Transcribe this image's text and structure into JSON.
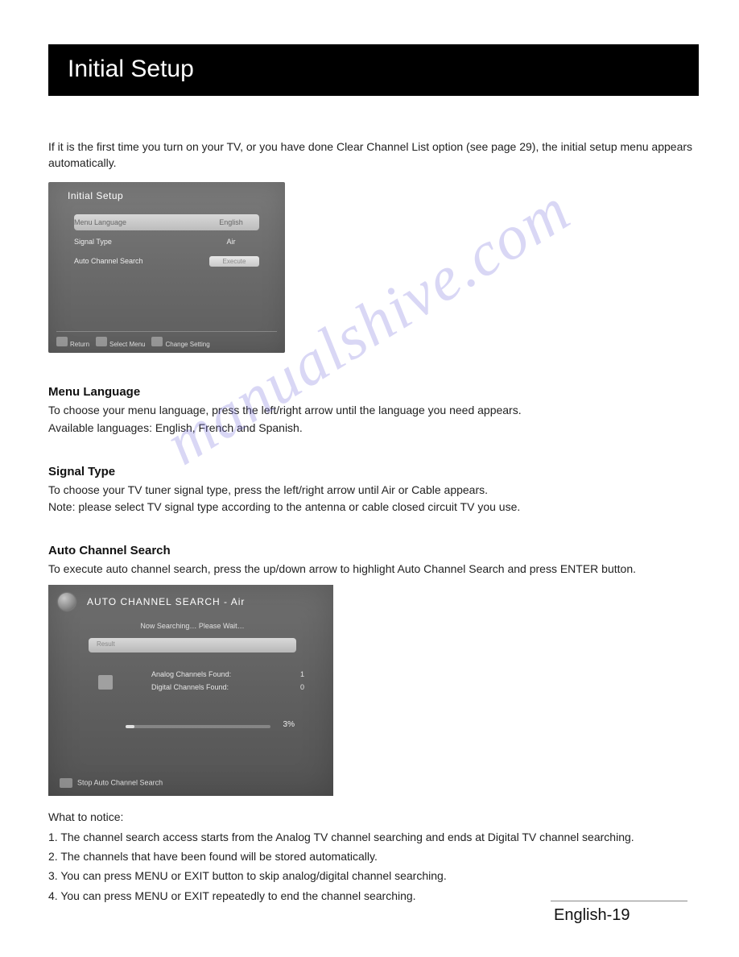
{
  "header": {
    "title": "Initial Setup"
  },
  "intro": "If it is the first time you turn on your TV, or you have done Clear Channel List option (see page 29), the initial setup menu appears automatically.",
  "osd1": {
    "title": "Initial Setup",
    "rows": [
      {
        "label": "Menu Language",
        "value": "English"
      },
      {
        "label": "Signal Type",
        "value": "Air"
      },
      {
        "label": "Auto Channel Search",
        "value": "Execute"
      }
    ],
    "footer": {
      "return": "Return",
      "select": "Select Menu",
      "change": "Change Setting"
    }
  },
  "sections": {
    "menuLanguage": {
      "heading": "Menu Language",
      "line1": "To choose your menu language, press the left/right arrow until the language you need appears.",
      "line2": "Available languages: English, French and Spanish."
    },
    "signalType": {
      "heading": "Signal Type",
      "line1": "To choose your TV tuner signal type, press the left/right arrow until Air or Cable appears.",
      "line2": "Note: please select TV signal type according to the antenna or cable closed circuit TV you use."
    },
    "autoChannel": {
      "heading": "Auto Channel Search",
      "line1": "To execute auto channel search, press the up/down arrow to highlight Auto Channel Search and press ENTER button."
    }
  },
  "osd2": {
    "title": "AUTO CHANNEL SEARCH - Air",
    "status": "Now Searching… Please Wait…",
    "result_label": "Result",
    "analog": {
      "label": "Analog Channels Found:",
      "value": "1"
    },
    "digital": {
      "label": "Digital Channels Found:",
      "value": "0"
    },
    "percent": "3%",
    "footer": "Stop Auto Channel Search"
  },
  "notice": {
    "heading": "What to notice:",
    "items": [
      "1. The channel search access starts from the Analog TV channel searching and ends at Digital TV channel searching.",
      "2. The channels that have been found will be stored automatically.",
      "3. You can press MENU or EXIT button to skip analog/digital channel searching.",
      "4. You can press MENU or EXIT repeatedly to end the channel searching."
    ]
  },
  "pageNumber": "English-19",
  "watermark": "manualshive.com"
}
